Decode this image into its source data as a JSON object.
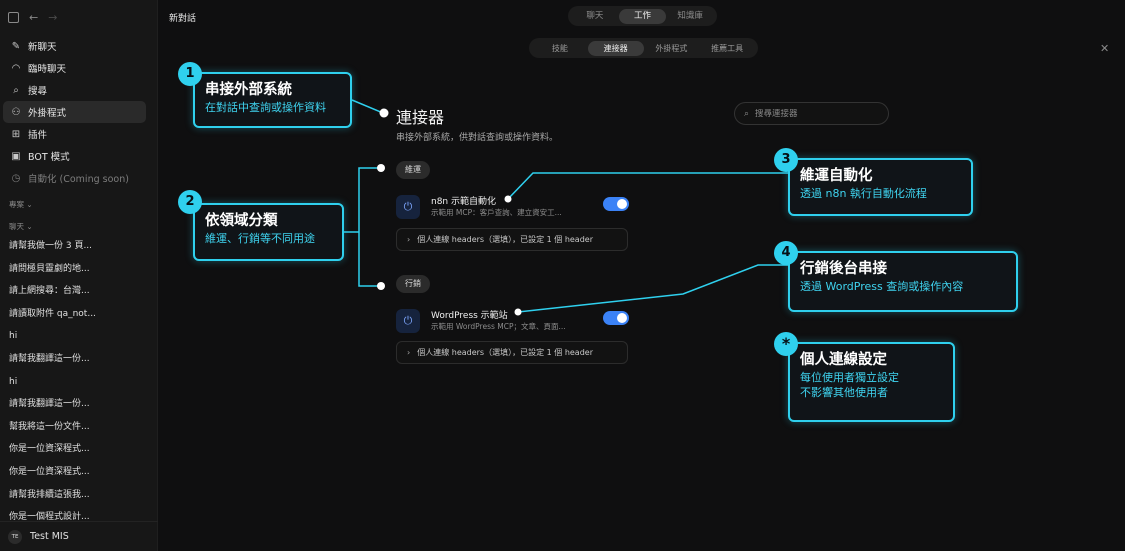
{
  "sidebar": {
    "nav": [
      {
        "label": "新聊天",
        "icon": "edit-icon"
      },
      {
        "label": "臨時聊天",
        "icon": "ghost-icon"
      },
      {
        "label": "搜尋",
        "icon": "search-icon"
      },
      {
        "label": "外掛程式",
        "icon": "plugin-icon"
      },
      {
        "label": "插件",
        "icon": "puzzle-icon"
      },
      {
        "label": "BOT 模式",
        "icon": "bot-icon"
      },
      {
        "label": "自動化 (Coming soon)",
        "icon": "clock-icon"
      }
    ],
    "section_projects": "專案 ⌄",
    "section_chats": "聊天 ⌄",
    "chats": [
      "請幫我做一份 3 頁...",
      "請問極貝靈劇的地...",
      "請上網搜尋：台灣...",
      "請讀取附件 qa_not...",
      "hi",
      "請幫我翻譯這一份...",
      "hi",
      "請幫我翻譯這一份...",
      "幫我將這一份文件...",
      "你是一位資深程式...",
      "你是一位資深程式...",
      "請幫我排續這張我...",
      "你是一個程式設計..."
    ],
    "user": {
      "initials": "TE",
      "name": "Test MIS"
    }
  },
  "header": {
    "title": "新對話",
    "mode_tabs": [
      "聊天",
      "工作",
      "知識庫"
    ],
    "sub_tabs": [
      "技能",
      "連接器",
      "外掛程式",
      "推薦工具"
    ]
  },
  "panel": {
    "title": "連接器",
    "subtitle": "串接外部系統，供對話查詢或操作資料。",
    "search_placeholder": "搜尋連接器",
    "groups": [
      {
        "label": "維運",
        "connector": {
          "name": "n8n 示範自動化",
          "desc": "示範用 MCP：客戶查詢、建立資安工...",
          "enabled": true
        },
        "headers": "個人連線 headers（選填），已設定 1 個 header"
      },
      {
        "label": "行銷",
        "connector": {
          "name": "WordPress 示範站",
          "desc": "示範用 WordPress MCP；文章、頁面...",
          "enabled": true
        },
        "headers": "個人連線 headers（選填），已設定 1 個 header"
      }
    ]
  },
  "callouts": [
    {
      "badge": "1",
      "title": "串接外部系統",
      "sub": [
        "在對話中查詢或操作資料"
      ]
    },
    {
      "badge": "2",
      "title": "依領域分類",
      "sub": [
        "維運、行銷等不同用途"
      ]
    },
    {
      "badge": "3",
      "title": "維運自動化",
      "sub": [
        "透過 n8n 執行自動化流程"
      ]
    },
    {
      "badge": "4",
      "title": "行銷後台串接",
      "sub": [
        "透過 WordPress 查詢或操作內容"
      ]
    },
    {
      "badge": "*",
      "title": "個人連線設定",
      "sub": [
        "每位使用者獨立設定",
        "不影響其他使用者"
      ]
    }
  ],
  "colors": {
    "accent": "#2fd0ee",
    "toggle": "#3b82f6",
    "background": "#0f0f10"
  }
}
